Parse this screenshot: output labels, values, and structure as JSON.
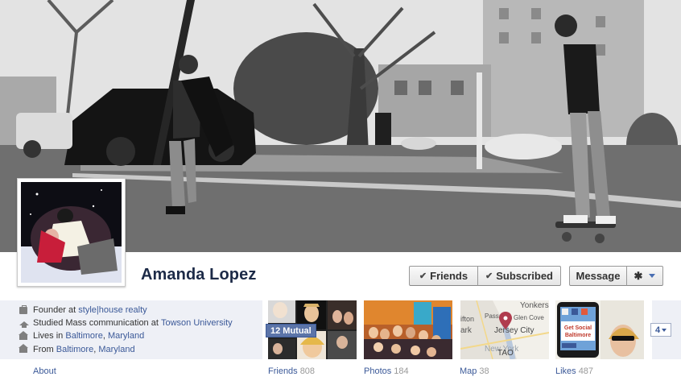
{
  "profile": {
    "name": "Amanda Lopez"
  },
  "actions": {
    "friends_label": "Friends",
    "subscribed_label": "Subscribed",
    "message_label": "Message"
  },
  "info": {
    "work": {
      "prefix": "Founder at",
      "link": "style|house realty"
    },
    "education": {
      "prefix": "Studied Mass communication at",
      "link": "Towson University"
    },
    "lives": {
      "prefix": "Lives in",
      "city": "Baltimore",
      "sep": ",",
      "state": "Maryland"
    },
    "from": {
      "prefix": "From",
      "city": "Baltimore",
      "sep": ",",
      "state": "Maryland"
    },
    "about_label": "About"
  },
  "tiles": {
    "friends": {
      "label": "Friends",
      "count": "808",
      "badge": "12 Mutual"
    },
    "photos": {
      "label": "Photos",
      "count": "184"
    },
    "map": {
      "label": "Map",
      "count": "38",
      "map_text": [
        "Yonkers",
        "Glen Cove",
        "Passaic",
        "Jersey City",
        "ifton",
        "ark",
        "New York",
        "TAO"
      ]
    },
    "likes": {
      "label": "Likes",
      "count": "487",
      "sign_text": [
        "Get Social",
        "Baltimore"
      ]
    },
    "more": {
      "count": "4"
    }
  },
  "icons": {
    "work": "briefcase-icon",
    "education": "graduation-cap-icon",
    "lives": "house-icon",
    "from": "house-icon",
    "gear": "gear-icon",
    "check": "check-icon",
    "caret": "caret-down-icon"
  },
  "colors": {
    "brand": "#3b5998",
    "name": "#1c2a47",
    "info_bg": "#eef0f6",
    "badge": "#5b74a8"
  }
}
